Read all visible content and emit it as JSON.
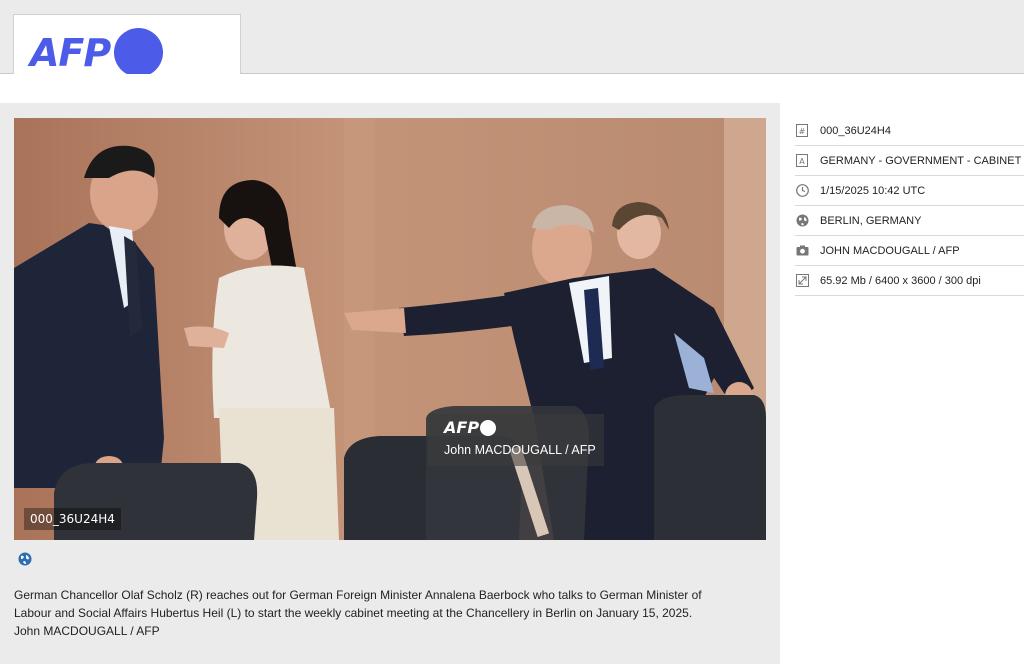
{
  "header": {
    "logo_text": "AFP",
    "brand_color": "#4c5be8"
  },
  "photo": {
    "id_overlay": "000_36U24H4",
    "watermark_logo": "AFP",
    "watermark_credit": "John MACDOUGALL / AFP"
  },
  "caption": {
    "line1": "German Chancellor Olaf Scholz (R) reaches out for German Foreign Minister Annalena Baerbock who talks to German Minister of",
    "line2": "Labour and Social Affairs Hubertus Heil (L) to start the weekly cabinet meeting at the Chancellery in Berlin on January 15, 2025.",
    "line3": "John MACDOUGALL / AFP"
  },
  "metadata": [
    {
      "icon": "id-icon",
      "value": "000_36U24H4"
    },
    {
      "icon": "category-icon",
      "value": "GERMANY - GOVERNMENT - CABINET"
    },
    {
      "icon": "clock-icon",
      "value": "1/15/2025 10:42 UTC"
    },
    {
      "icon": "globe-icon",
      "value": "BERLIN, GERMANY"
    },
    {
      "icon": "camera-icon",
      "value": "JOHN MACDOUGALL / AFP"
    },
    {
      "icon": "resize-icon",
      "value": "65.92 Mb / 6400 x 3600 / 300 dpi"
    }
  ]
}
